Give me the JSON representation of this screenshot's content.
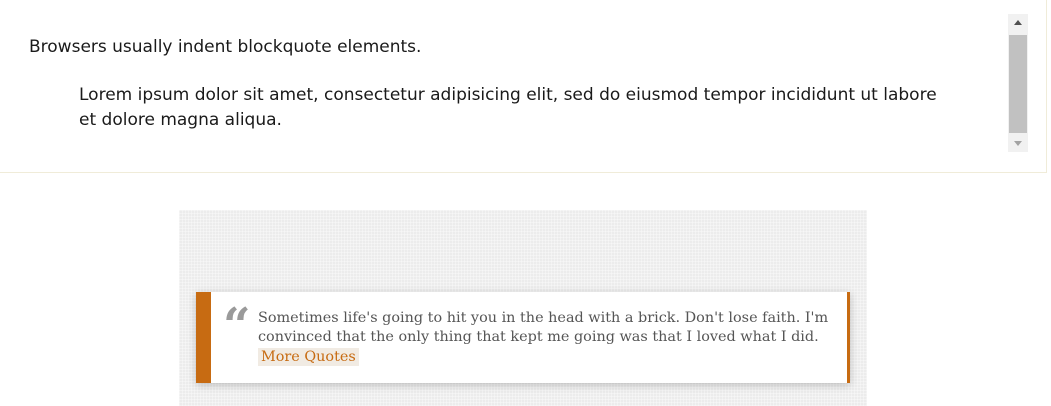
{
  "result": {
    "intro_text": "Browsers usually indent blockquote elements.",
    "blockquote_text": "Lorem ipsum dolor sit amet, consectetur adipisicing elit, sed do eiusmod tempor incididunt ut labore et dolore magna aliqua."
  },
  "scrollbar": {
    "up_icon": "scroll-up-arrow",
    "down_icon": "scroll-down-arrow"
  },
  "demo": {
    "quote_mark": "“",
    "quote_text": "Sometimes life's going to hit you in the head with a brick. Don't lose faith. I'm convinced that the only thing that kept me going was that I loved what I did.",
    "more_link_label": "More Quotes",
    "accent_color": "#c76b12",
    "background_color": "#ececec"
  }
}
